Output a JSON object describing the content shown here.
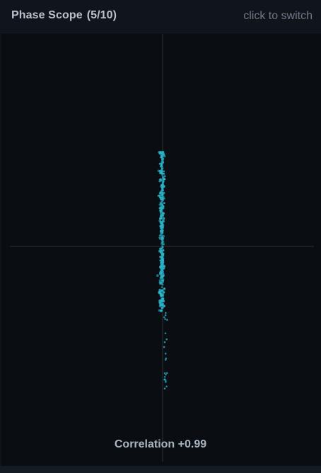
{
  "header": {
    "title": "Phase Scope",
    "counter": "(5/10)",
    "switch_hint": "click to switch"
  },
  "scope": {
    "correlation_label": "Correlation",
    "correlation_value": "+0.99",
    "dot_color": "#2bb3c8",
    "axis_color": "#2a3138"
  },
  "colors": {
    "background": "#0a0e13",
    "header_bg": "#10151b",
    "title_text": "#b9c2cc",
    "hint_text": "#6f7a86"
  }
}
